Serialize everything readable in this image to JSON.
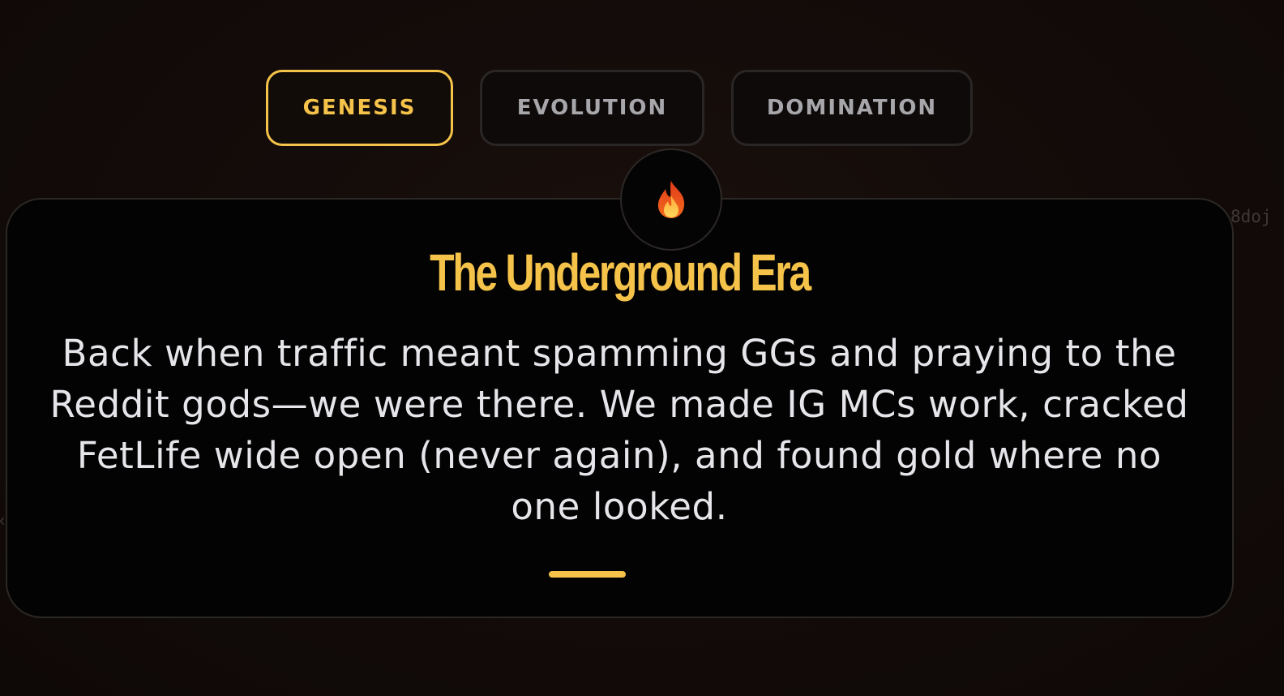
{
  "tabs": [
    {
      "label": "GENESIS",
      "active": true
    },
    {
      "label": "EVOLUTION",
      "active": false
    },
    {
      "label": "DOMINATION",
      "active": false
    }
  ],
  "card": {
    "icon": "fire-icon",
    "title": "The Underground Era",
    "description": "Back when traffic meant spamming GGs and praying to the Reddit gods—we were there. We made IG MCs work, cracked FetLife wide open (never again), and found gold where no one looked."
  },
  "edge_text": "8doj",
  "colors": {
    "accent": "#f5c34a",
    "background": "#120b09",
    "card": "#040303",
    "text": "#e6e5ea",
    "inactive_tab_text": "#a7a6aa"
  }
}
